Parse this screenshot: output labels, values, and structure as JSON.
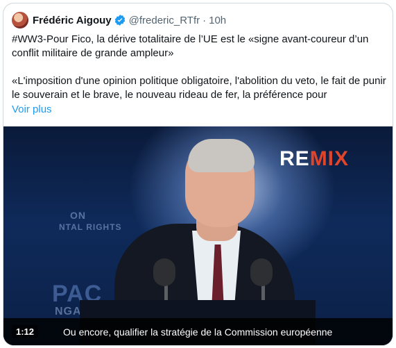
{
  "tweet": {
    "author_name": "Frédéric Aigouy",
    "handle": "@frederic_RTfr",
    "separator": "·",
    "time": "10h",
    "text_line1": "#WW3-Pour Fico, la dérive totalitaire de l’UE est le «signe avant-coureur d’un conflit militaire de grande ampleur»",
    "text_line2": "«L'imposition d'une opinion politique obligatoire, l'abolition du veto, le fait de punir le souverain et le brave, le nouveau rideau de fer, la préférence  pour",
    "show_more": "Voir plus",
    "verified_color": "#1d9bf0"
  },
  "video": {
    "remix_left": "RE",
    "remix_right": "MIX",
    "remix_accent": "#e0452b",
    "timecode": "1:12",
    "caption": "Ou encore, qualifier la stratégie de la Commission européenne",
    "bg_text_1": "ON",
    "bg_text_2": "NTAL RIGHTS",
    "bg_text_3": "PAC",
    "bg_text_4": "NGARY"
  }
}
